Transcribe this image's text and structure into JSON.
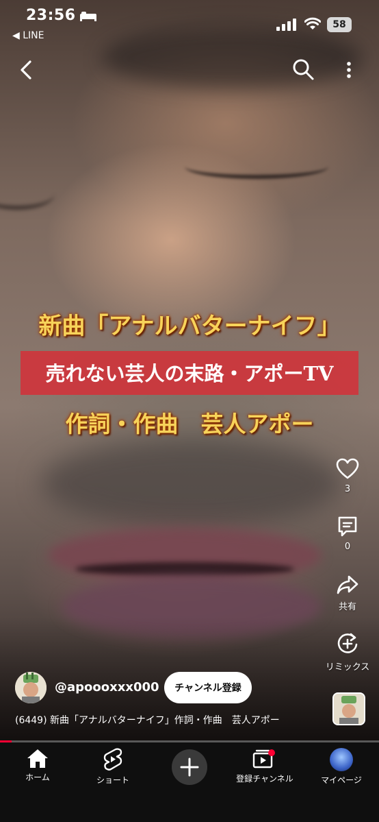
{
  "status_bar": {
    "time": "23:56",
    "back_app": "◀ LINE",
    "battery": "58"
  },
  "video": {
    "title_line1": "新曲「アナルバターナイフ」",
    "title_line2": "売れない芸人の末路・アポーTV",
    "title_line3": "作詞・作曲　芸人アポー",
    "progress": 0.03
  },
  "actions": {
    "like_count": "3",
    "comment_count": "0",
    "share_label": "共有",
    "remix_label": "リミックス"
  },
  "channel": {
    "handle": "@apoooxxx000",
    "subscribe_label": "チャンネル登録",
    "caption": "(6449) 新曲「アナルバターナイフ」作詞・作曲　芸人アポー"
  },
  "bottom_nav": {
    "home": "ホーム",
    "shorts": "ショート",
    "subscriptions": "登録チャンネル",
    "you": "マイページ"
  },
  "colors": {
    "accent_red": "#ff0033",
    "banner_red": "#ce363c",
    "title_gold": "#f7d35a"
  }
}
